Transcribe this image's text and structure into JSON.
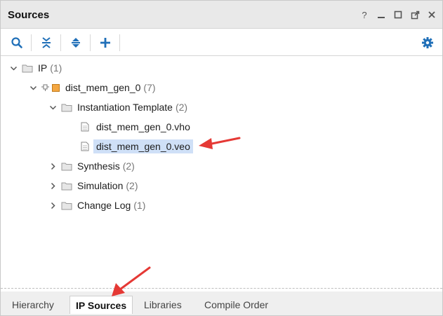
{
  "window": {
    "title": "Sources",
    "controls": [
      "help-icon",
      "minimize-icon",
      "restore-icon",
      "float-icon",
      "close-icon"
    ],
    "help_label": "?"
  },
  "toolbar": {
    "buttons": [
      "search-icon",
      "collapse-all-icon",
      "expand-all-icon",
      "add-icon",
      "gear-icon"
    ]
  },
  "tree": {
    "root": {
      "label": "IP",
      "count": "(1)"
    },
    "ip": {
      "label": "dist_mem_gen_0",
      "count": "(7)"
    },
    "inst": {
      "label": "Instantiation Template",
      "count": "(2)"
    },
    "file1": {
      "label": "dist_mem_gen_0.vho"
    },
    "file2": {
      "label": "dist_mem_gen_0.veo"
    },
    "synth": {
      "label": "Synthesis",
      "count": "(2)"
    },
    "sim": {
      "label": "Simulation",
      "count": "(2)"
    },
    "log": {
      "label": "Change Log",
      "count": "(1)"
    }
  },
  "tabs": {
    "hierarchy": "Hierarchy",
    "ip_sources": "IP Sources",
    "libraries": "Libraries",
    "compile_order": "Compile Order",
    "active": "IP Sources"
  },
  "colors": {
    "accent": "#1f6fb8",
    "selection": "#cfe0f7",
    "annotation_arrow": "#e53935"
  }
}
